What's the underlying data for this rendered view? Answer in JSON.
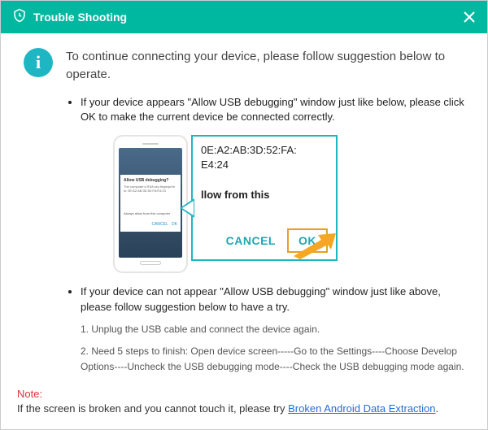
{
  "titlebar": {
    "title": "Trouble Shooting"
  },
  "info_icon_glyph": "i",
  "header_text": "To continue connecting your device, please follow suggestion below to operate.",
  "bullet1": "If your device appears \"Allow USB debugging\" window just like below, please click OK to make the current device  be connected correctly.",
  "bullet2": "If your device can not appear \"Allow USB debugging\" window just like above, please follow suggestion below to have a try.",
  "substep1": "1. Unplug the USB cable and connect the device again.",
  "substep2": "2. Need 5 steps to finish: Open device screen-----Go to the Settings----Choose Develop Options----Uncheck the USB debugging mode----Check the USB debugging mode again.",
  "phone_dialog": {
    "title": "Allow USB debugging?",
    "body": "The computer's RSA key fingerprint is: 0E:A2:AB:3D:52:FA:E4:24",
    "check": "Always allow from this computer",
    "cancel": "CANCEL",
    "ok": "OK"
  },
  "zoom": {
    "mac_line": "0E:A2:AB:3D:52:FA:\nE4:24",
    "allow_line": "llow from this",
    "cancel": "CANCEL",
    "ok": "OK"
  },
  "footer": {
    "note_label": "Note:",
    "text_before": "If the screen is broken and you cannot touch it, please try ",
    "link": "Broken Android Data Extraction",
    "text_after": "."
  }
}
